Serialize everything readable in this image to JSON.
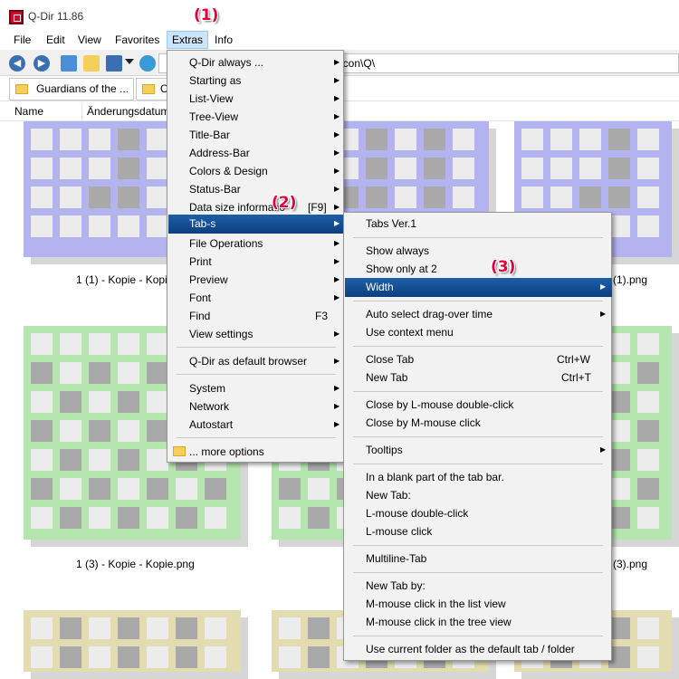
{
  "window": {
    "title": "Q-Dir 11.86"
  },
  "menubar": {
    "file": "File",
    "edit": "Edit",
    "view": "View",
    "favorites": "Favorites",
    "extras": "Extras",
    "info": "Info"
  },
  "address": {
    "value": "g\\icon\\Q\\"
  },
  "tabs": {
    "active": "Guardians of the ...",
    "second": "C"
  },
  "columns": {
    "name": "Name",
    "date": "Änderungsdatum"
  },
  "files": [
    {
      "label": "1 (1) - Kopie - Kopi"
    },
    {
      "label": "(1).png"
    },
    {
      "label": "1 (3) - Kopie - Kopie.png"
    },
    {
      "label": "(3).png"
    }
  ],
  "extras_menu": {
    "items": [
      "Q-Dir always ...",
      "Starting as",
      "List-View",
      "Tree-View",
      "Title-Bar",
      "Address-Bar",
      "Colors & Design",
      "Status-Bar",
      "Data size informatio",
      "Tab-s",
      "File Operations",
      "Print",
      "Preview",
      "Font",
      "Find",
      "View settings",
      "Q-Dir as default browser",
      "System",
      "Network",
      "Autostart",
      "... more options"
    ],
    "shortcuts": {
      "data_size": "[F9]",
      "find": "F3"
    }
  },
  "tabs_menu": {
    "items": [
      "Tabs Ver.1",
      "Show always",
      "Show only at 2",
      "Width",
      "Auto select drag-over time",
      "Use context menu",
      "Close Tab",
      "New Tab",
      "Close by L-mouse double-click",
      "Close by M-mouse click",
      "Tooltips",
      "In a blank part of the tab bar.",
      "New Tab:",
      "L-mouse double-click",
      "L-mouse click",
      "Multiline-Tab",
      "New Tab by:",
      "M-mouse click in the list view",
      "M-mouse click in the tree view",
      "Use current folder as the default tab / folder"
    ],
    "shortcuts": {
      "close_tab": "Ctrl+W",
      "new_tab": "Ctrl+T"
    }
  },
  "annotations": {
    "a1": "(1)",
    "a2": "(2)",
    "a3": "(3)"
  },
  "colors": {
    "highlight": "#0d3f80",
    "annotation": "#e4003a",
    "thumb_purple": "#b3b3f0",
    "thumb_green": "#b5e6b0",
    "thumb_yellow": "#e3dcb0",
    "cell_light": "#ececec",
    "cell_dark": "#a9a9a9"
  },
  "icons": [
    "app-icon",
    "back-icon",
    "forward-icon",
    "up-icon",
    "folder-icon",
    "view-icon",
    "dropdown-icon",
    "refresh-icon",
    "submenu-arrow-icon"
  ]
}
